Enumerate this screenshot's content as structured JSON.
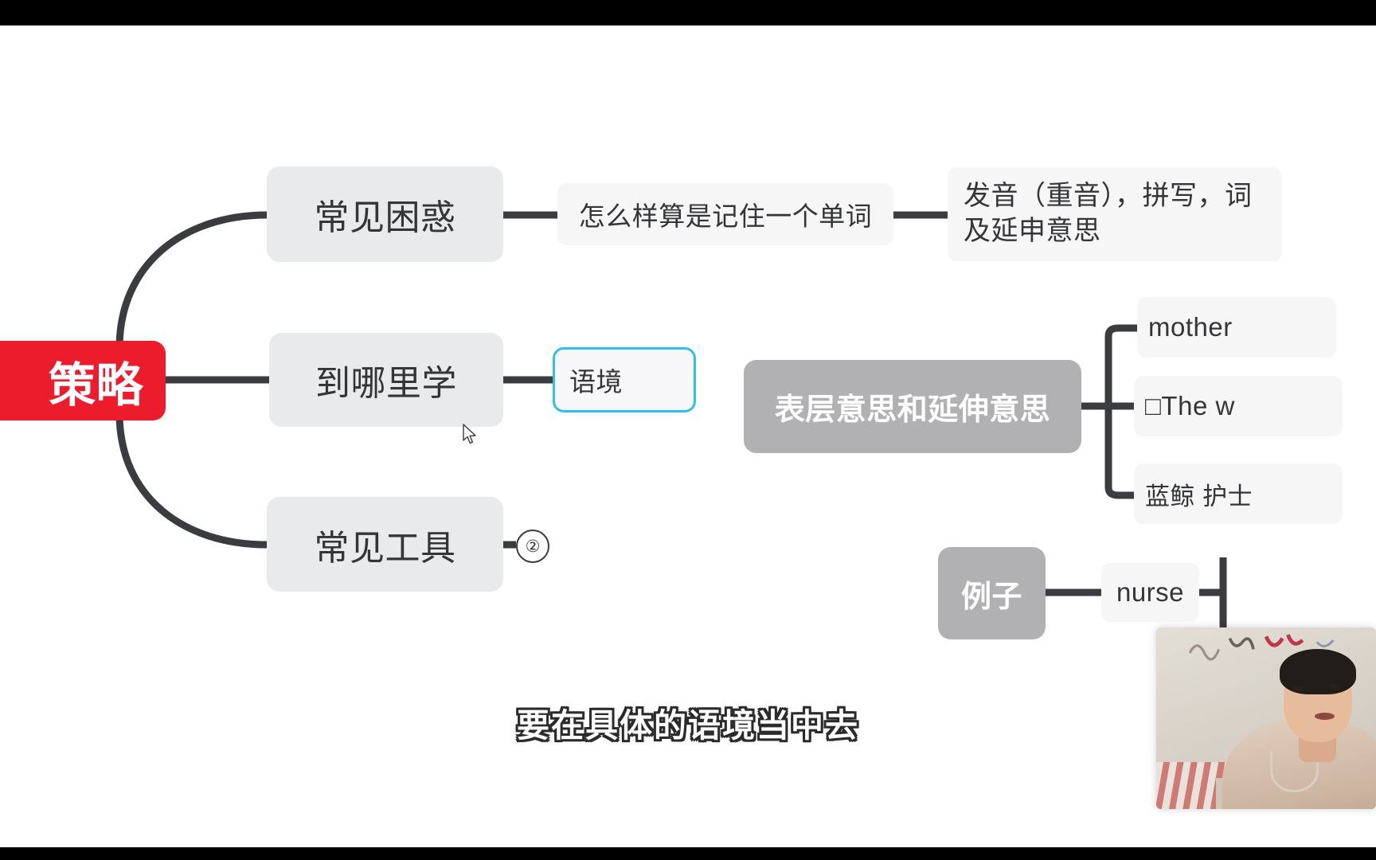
{
  "app": {
    "canvas_background": "#ffffff",
    "letterbox_color": "#000000"
  },
  "mindmap": {
    "root": {
      "label": "策略",
      "color": "#ec1c2d",
      "text_color": "#ffffff"
    },
    "branches": [
      {
        "label": "常见困惑",
        "style": "light-grey",
        "children": [
          {
            "label": "怎么样算是记住一个单词",
            "style": "plain",
            "children": [
              {
                "label": "发音（重音），拼写，词及延申意思",
                "style": "plain-wrap"
              }
            ]
          }
        ]
      },
      {
        "label": "到哪里学",
        "style": "light-grey",
        "children": [
          {
            "label": "语境",
            "style": "selected",
            "selected": true,
            "selection_color": "#35bdea"
          }
        ]
      },
      {
        "label": "常见工具",
        "style": "light-grey",
        "collapsed_count": "②"
      }
    ],
    "floating_nodes": [
      {
        "label": "表层意思和延伸意思",
        "style": "dark-grey",
        "children": [
          {
            "label": "mother",
            "style": "plain"
          },
          {
            "label": "□The w",
            "style": "plain"
          },
          {
            "label": "蓝鲸 护士",
            "style": "plain"
          }
        ]
      },
      {
        "label": "例子",
        "style": "dark-grey",
        "children": [
          {
            "label": "nurse",
            "style": "plain"
          }
        ]
      }
    ]
  },
  "subtitle": {
    "text": "要在具体的语境当中去"
  },
  "cursor": {
    "icon": "arrow-pointer"
  },
  "webcam": {
    "label": "presenter-webcam-overlay"
  }
}
